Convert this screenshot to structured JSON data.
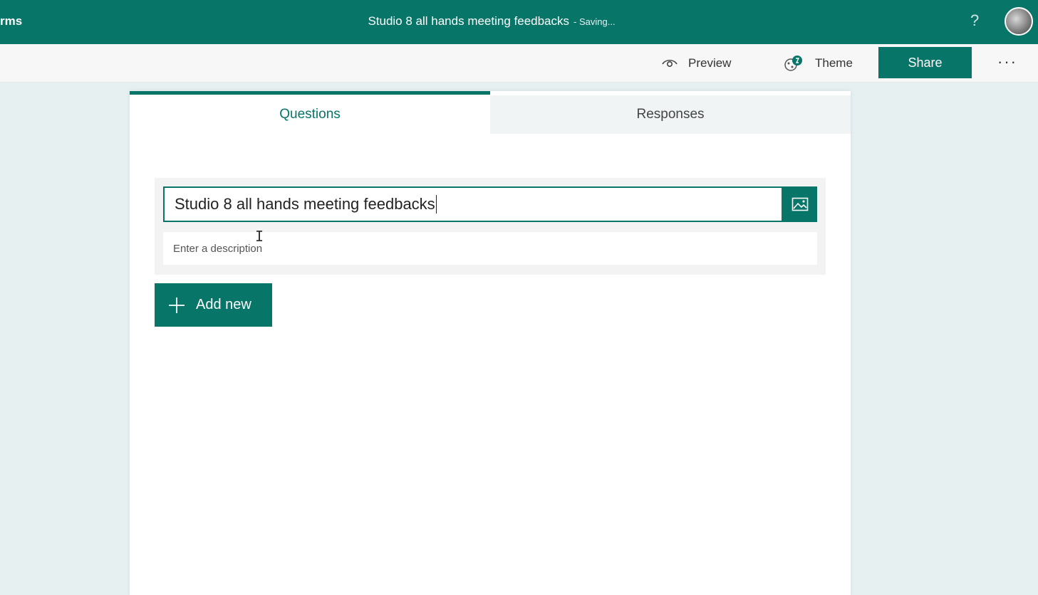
{
  "app": {
    "name": "rms",
    "document_title": "Studio 8 all hands meeting feedbacks",
    "save_status": "- Saving...",
    "help_label": "?"
  },
  "commands": {
    "preview_label": "Preview",
    "theme_label": "Theme",
    "share_label": "Share",
    "more_label": "···"
  },
  "tabs": [
    {
      "label": "Questions",
      "active": true
    },
    {
      "label": "Responses",
      "active": false
    }
  ],
  "form": {
    "title_value": "Studio 8 all hands meeting feedbacks",
    "description_placeholder": "Enter a description",
    "add_new_label": "Add new"
  },
  "colors": {
    "brand": "#077568",
    "page_bg": "#e6f0f0",
    "toolbar_bg": "#f7f7f7"
  },
  "icons": {
    "preview": "eye-icon",
    "theme": "palette-icon",
    "image": "image-icon",
    "add": "plus-icon",
    "more": "ellipsis-icon"
  }
}
